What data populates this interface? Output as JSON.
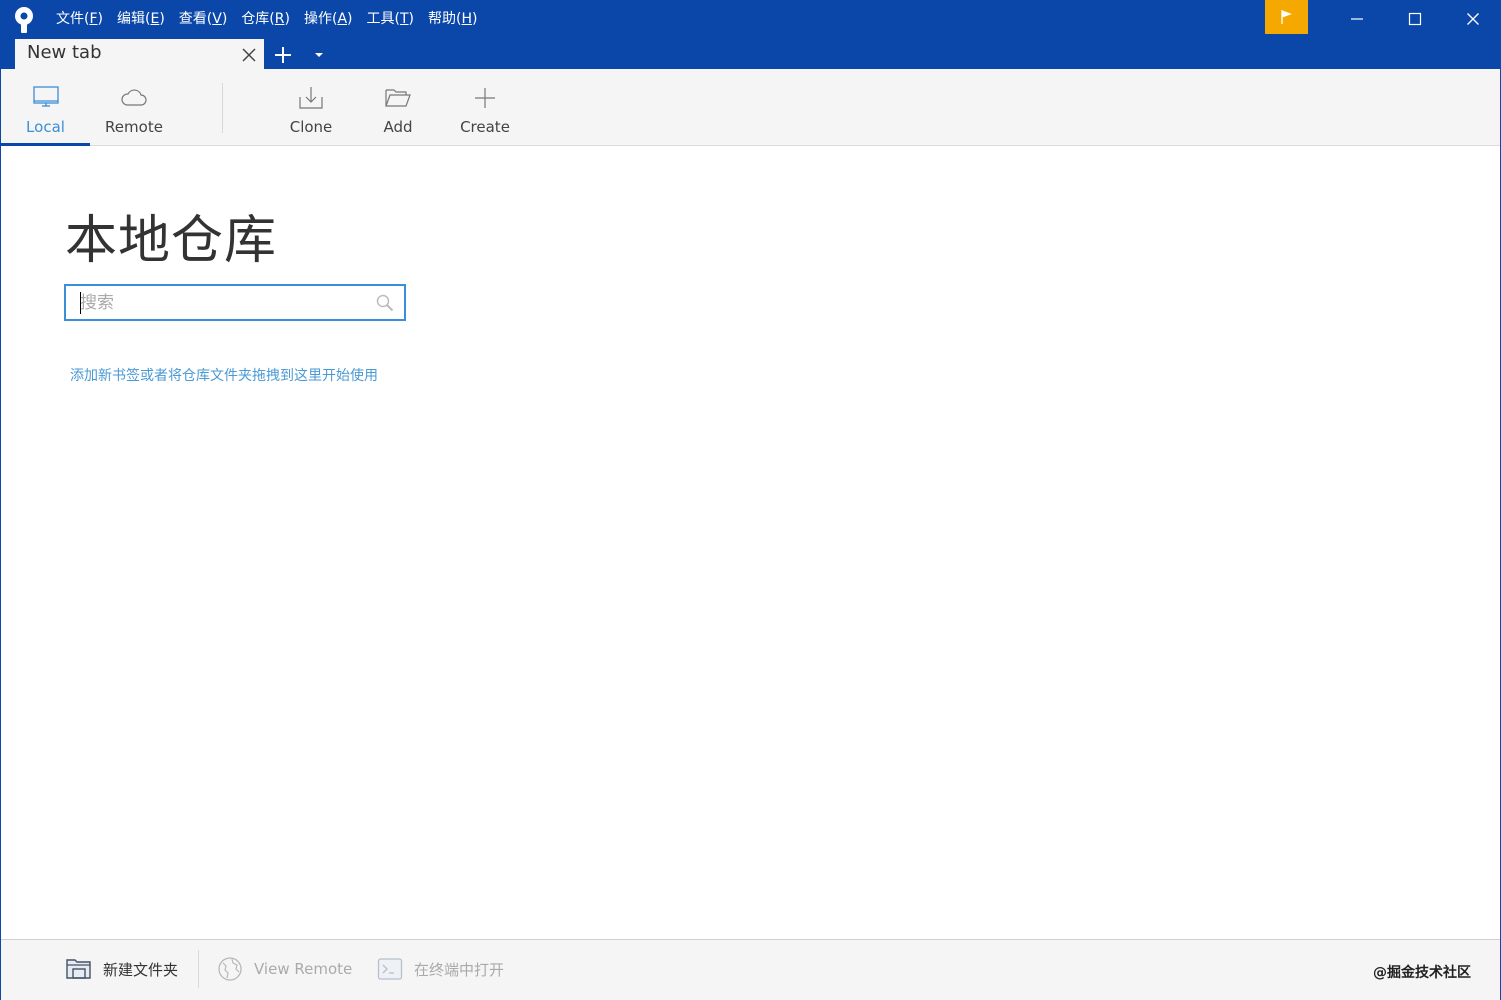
{
  "titlebar": {
    "menu": [
      {
        "label": "文件(",
        "key": "F",
        "suffix": ")"
      },
      {
        "label": "编辑(",
        "key": "E",
        "suffix": ")"
      },
      {
        "label": "查看(",
        "key": "V",
        "suffix": ")"
      },
      {
        "label": "仓库(",
        "key": "R",
        "suffix": ")"
      },
      {
        "label": "操作(",
        "key": "A",
        "suffix": ")"
      },
      {
        "label": "工具(",
        "key": "T",
        "suffix": ")"
      },
      {
        "label": "帮助(",
        "key": "H",
        "suffix": ")"
      }
    ],
    "accent_color": "#0a47a9",
    "flag_color": "#f5a800"
  },
  "tabs": [
    {
      "title": "New tab",
      "active": true
    }
  ],
  "toolbar": {
    "local": "Local",
    "remote": "Remote",
    "clone": "Clone",
    "add": "Add",
    "create": "Create",
    "active_color": "#3b8ed8"
  },
  "main": {
    "title": "本地仓库",
    "search_placeholder": "搜索",
    "search_value": "",
    "hint": "添加新书签或者将仓库文件夹拖拽到这里开始使用"
  },
  "bottombar": {
    "new_folder": "新建文件夹",
    "view_remote": "View Remote",
    "open_terminal": "在终端中打开"
  },
  "watermark": "@掘金技术社区"
}
